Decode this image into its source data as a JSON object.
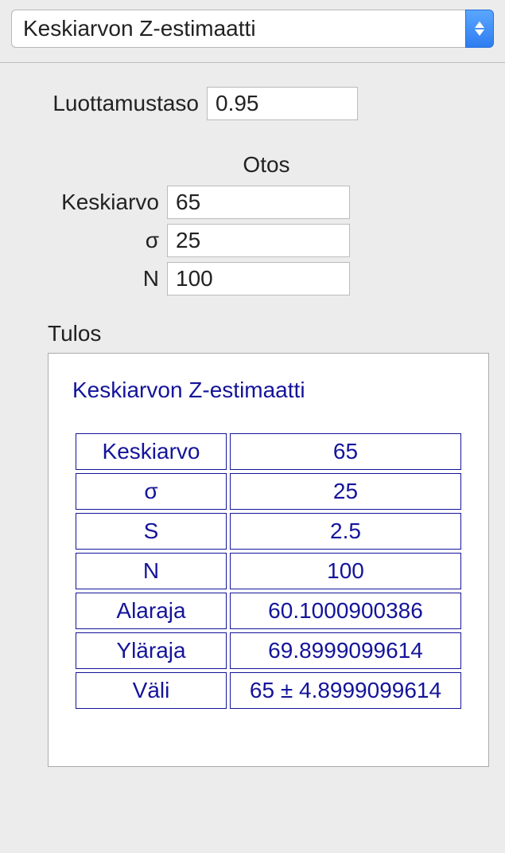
{
  "dropdown": {
    "selected": "Keskiarvon Z-estimaatti"
  },
  "form": {
    "confidence_label": "Luottamustaso",
    "confidence_value": "0.95",
    "sample_header": "Otos",
    "mean_label": "Keskiarvo",
    "mean_value": "65",
    "sigma_label": "σ",
    "sigma_value": "25",
    "n_label": "N",
    "n_value": "100"
  },
  "result": {
    "section_label": "Tulos",
    "title": "Keskiarvon Z-estimaatti",
    "rows": [
      {
        "label": "Keskiarvo",
        "value": "65"
      },
      {
        "label": "σ",
        "value": "25"
      },
      {
        "label": "S",
        "value": "2.5"
      },
      {
        "label": "N",
        "value": "100"
      },
      {
        "label": "Alaraja",
        "value": "60.1000900386"
      },
      {
        "label": "Yläraja",
        "value": "69.8999099614"
      },
      {
        "label": "Väli",
        "value": "65 ± 4.8999099614"
      }
    ]
  }
}
